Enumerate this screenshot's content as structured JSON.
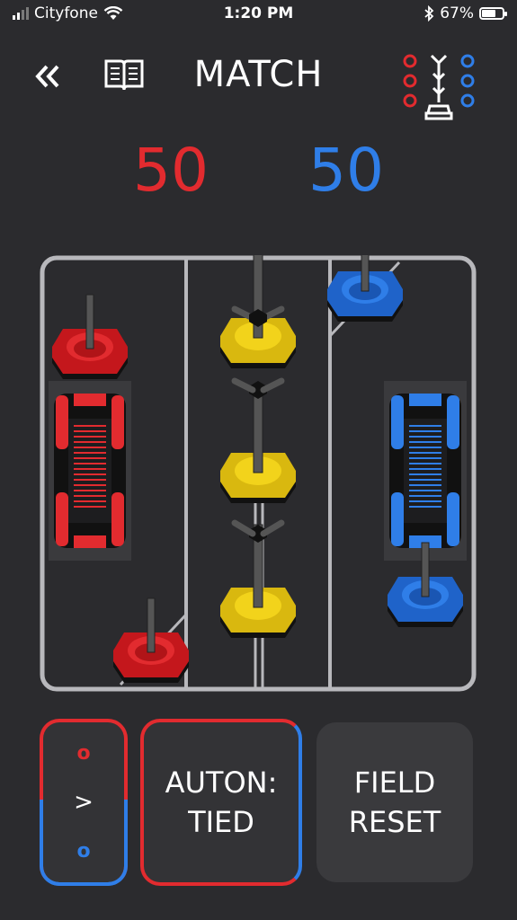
{
  "status_bar": {
    "carrier": "Cityfone",
    "time": "1:20 PM",
    "battery_percent": "67%",
    "battery_level": 0.67
  },
  "header": {
    "title": "MATCH"
  },
  "scores": {
    "red": "50",
    "blue": "50"
  },
  "buttons": {
    "swap_top": "o",
    "swap_arrow": ">",
    "swap_bottom": "o",
    "auton_line1": "AUTON:",
    "auton_line2": "TIED",
    "reset_line1": "FIELD",
    "reset_line2": "RESET"
  },
  "colors": {
    "red": "#e22b2f",
    "blue": "#2f7ee8",
    "yellow": "#f2d31b",
    "background": "#2b2b2e",
    "field_line": "#b8b8bc"
  },
  "icons": {
    "back": "double-chevron-left-icon",
    "rules": "book-icon",
    "field": "field-layout-icon",
    "wifi": "wifi-icon",
    "bluetooth": "bluetooth-icon",
    "battery": "battery-icon"
  }
}
